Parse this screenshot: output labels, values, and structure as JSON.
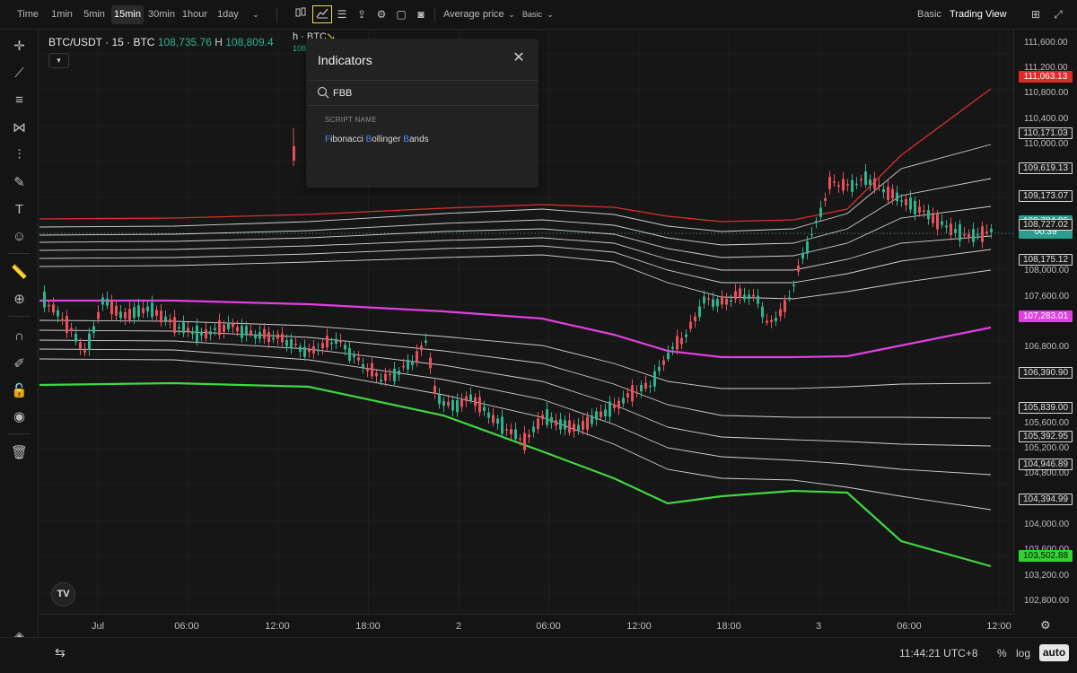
{
  "toolbar": {
    "time_label": "Time",
    "intervals": [
      "1min",
      "5min",
      "15min",
      "30min",
      "1hour",
      "1day"
    ],
    "active_interval": "15min",
    "price_type": "Average price",
    "layout_mode": "Basic",
    "views": [
      "Basic",
      "Trading View"
    ],
    "active_view": "Trading View"
  },
  "legend": {
    "symbol": "BTC/USDT · 15 · BTC",
    "open": "108,735.76",
    "high_label": "H",
    "high": "108,809.4",
    "study_label": "h · BTC",
    "study_value": "108"
  },
  "indicators_dialog": {
    "title": "Indicators",
    "search_value": "FBB",
    "section_label": "SCRIPT NAME",
    "result_parts": [
      {
        "t": "F",
        "m": true
      },
      {
        "t": "ibonacci ",
        "m": false
      },
      {
        "t": "B",
        "m": true
      },
      {
        "t": "ollinger ",
        "m": false
      },
      {
        "t": "B",
        "m": true
      },
      {
        "t": "ands",
        "m": false
      }
    ]
  },
  "price_scale": {
    "ticks": [
      "111,600.00",
      "111,200.00",
      "110,800.00",
      "110,400.00",
      "110,000.00",
      "108,000.00",
      "107,600.00",
      "106,800.00",
      "106,400.00",
      "105,600.00",
      "105,200.00",
      "104,800.00",
      "104,000.00",
      "103,600.00",
      "103,200.00",
      "102,800.00"
    ],
    "tags": [
      {
        "v": "111,063.13",
        "style": "red"
      },
      {
        "v": "110,171.03",
        "style": "w"
      },
      {
        "v": "109,619.13",
        "style": "w"
      },
      {
        "v": "109,173.07",
        "style": "w"
      },
      {
        "v": "108,784.86",
        "sub": "00:39",
        "style": "teal"
      },
      {
        "v": "108,727.02",
        "style": "w"
      },
      {
        "v": "108,175.12",
        "style": "w"
      },
      {
        "v": "107,283.01",
        "style": "mag"
      },
      {
        "v": "106,390.90",
        "style": "w"
      },
      {
        "v": "105,839.00",
        "style": "w"
      },
      {
        "v": "105,392.95",
        "style": "w"
      },
      {
        "v": "104,946.89",
        "style": "w"
      },
      {
        "v": "104,394.99",
        "style": "w"
      },
      {
        "v": "103,502.88",
        "style": "grn"
      }
    ]
  },
  "time_scale": {
    "ticks": [
      "Jul",
      "06:00",
      "12:00",
      "18:00",
      "2",
      "06:00",
      "12:00",
      "18:00",
      "3",
      "06:00",
      "12:00"
    ]
  },
  "bottom": {
    "clock": "11:44:21 UTC+8",
    "percent": "%",
    "log": "log",
    "auto": "auto"
  },
  "colors": {
    "up": "#2fb38f",
    "down": "#e8505b",
    "upper_band": "#d9302c",
    "basis": "#e040e0",
    "lower_band": "#3fd83f",
    "fib_band": "#d0d0d0",
    "highlight": "#e8e14a"
  }
}
